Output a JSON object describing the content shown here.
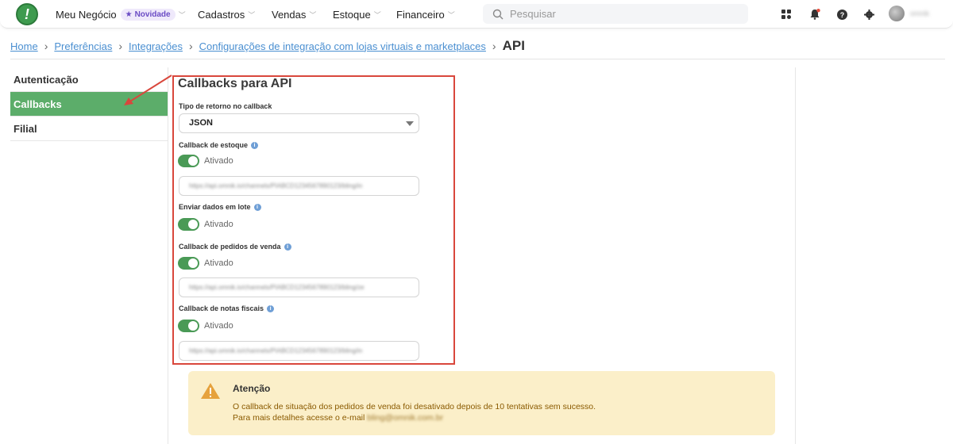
{
  "topbar": {
    "logo_glyph": "!",
    "nav": [
      {
        "label": "Meu Negócio",
        "badge": "Novidade"
      },
      {
        "label": "Cadastros"
      },
      {
        "label": "Vendas"
      },
      {
        "label": "Estoque"
      },
      {
        "label": "Financeiro"
      }
    ],
    "search_placeholder": "Pesquisar",
    "username": "omnik",
    "notification_dot_color": "#e74c3c"
  },
  "breadcrumb": {
    "items": [
      "Home",
      "Preferências",
      "Integrações",
      "Configurações de integração com lojas virtuais e marketplaces"
    ],
    "current": "API"
  },
  "sidebar": {
    "items": [
      {
        "label": "Autenticação",
        "active": false
      },
      {
        "label": "Callbacks",
        "active": true
      },
      {
        "label": "Filial",
        "active": false
      }
    ]
  },
  "panel": {
    "title": "Callbacks para API",
    "return_type_label": "Tipo de retorno no callback",
    "return_type_value": "JSON",
    "stock_label": "Callback de estoque",
    "stock_toggle": "Ativado",
    "stock_url": "https://api.omnik.io/channels/PIABCD1234567890123/bling/in",
    "batch_label": "Enviar dados em lote",
    "batch_toggle": "Ativado",
    "orders_label": "Callback de pedidos de venda",
    "orders_toggle": "Ativado",
    "orders_url": "https://api.omnik.io/channels/PIABCD1234567890123/bling/ze",
    "invoices_label": "Callback de notas fiscais",
    "invoices_toggle": "Ativado",
    "invoices_url": "https://api.omnik.io/channels/PIABCD1234567890123/bling/in"
  },
  "alert": {
    "title": "Atenção",
    "line1": "O callback de situação dos pedidos de venda foi desativado depois de 10 tentativas sem sucesso.",
    "line2_prefix": "Para mais detalhes acesse o e-mail",
    "email": "bling@omnik.com.br"
  },
  "colors": {
    "accent_green": "#5cad6a",
    "toggle_green": "#4a9a56",
    "highlight_red": "#d9473c",
    "link_blue": "#4a8fd1",
    "alert_bg": "#fbefc9"
  }
}
